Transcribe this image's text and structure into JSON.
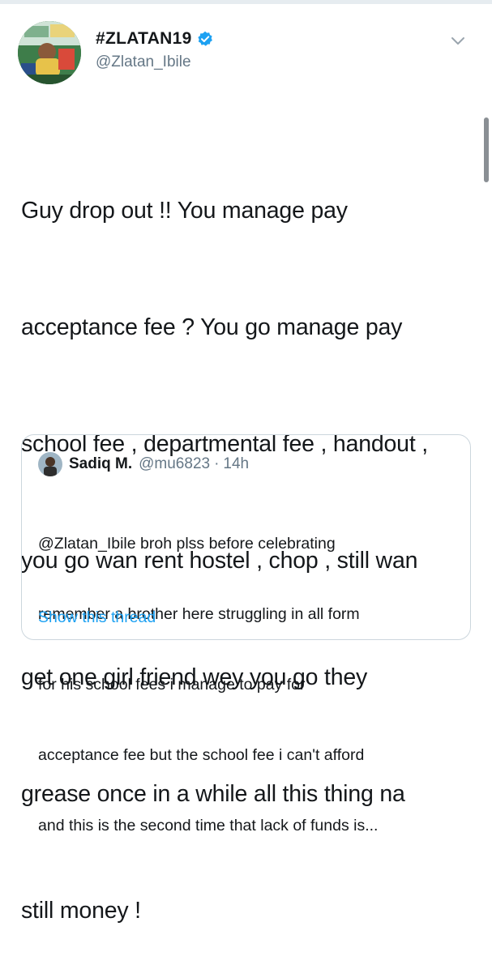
{
  "tweet": {
    "author": {
      "display_name": "#ZLATAN19",
      "handle": "@Zlatan_Ibile",
      "verified": true,
      "avatar_icon": "profile-photo"
    },
    "text_lines": [
      "Guy drop out !! You manage pay",
      "acceptance fee ? You go manage pay",
      "school fee , departmental fee , handout ,",
      "you go wan rent hostel , chop , still wan",
      "get one girl friend wey you go they",
      "grease once in a while all this thing na",
      "still money !"
    ],
    "menu_icon": "chevron-down-icon"
  },
  "quote": {
    "author": {
      "display_name": "Sadiq M.",
      "handle": "@mu6823",
      "separator": "·",
      "time": "14h"
    },
    "text_lines": [
      "@Zlatan_Ibile broh plss before celebrating",
      "remember a brother here struggling in all form",
      "for his school fees i manage to pay for",
      "acceptance fee but the school fee i can't afford",
      "and this is the second time that lack of funds is..."
    ],
    "show_thread_label": "Show this thread"
  },
  "colors": {
    "text": "#14171a",
    "secondary": "#657786",
    "link": "#1da1f2",
    "verified": "#1da1f2",
    "border": "#ccd6dd"
  }
}
